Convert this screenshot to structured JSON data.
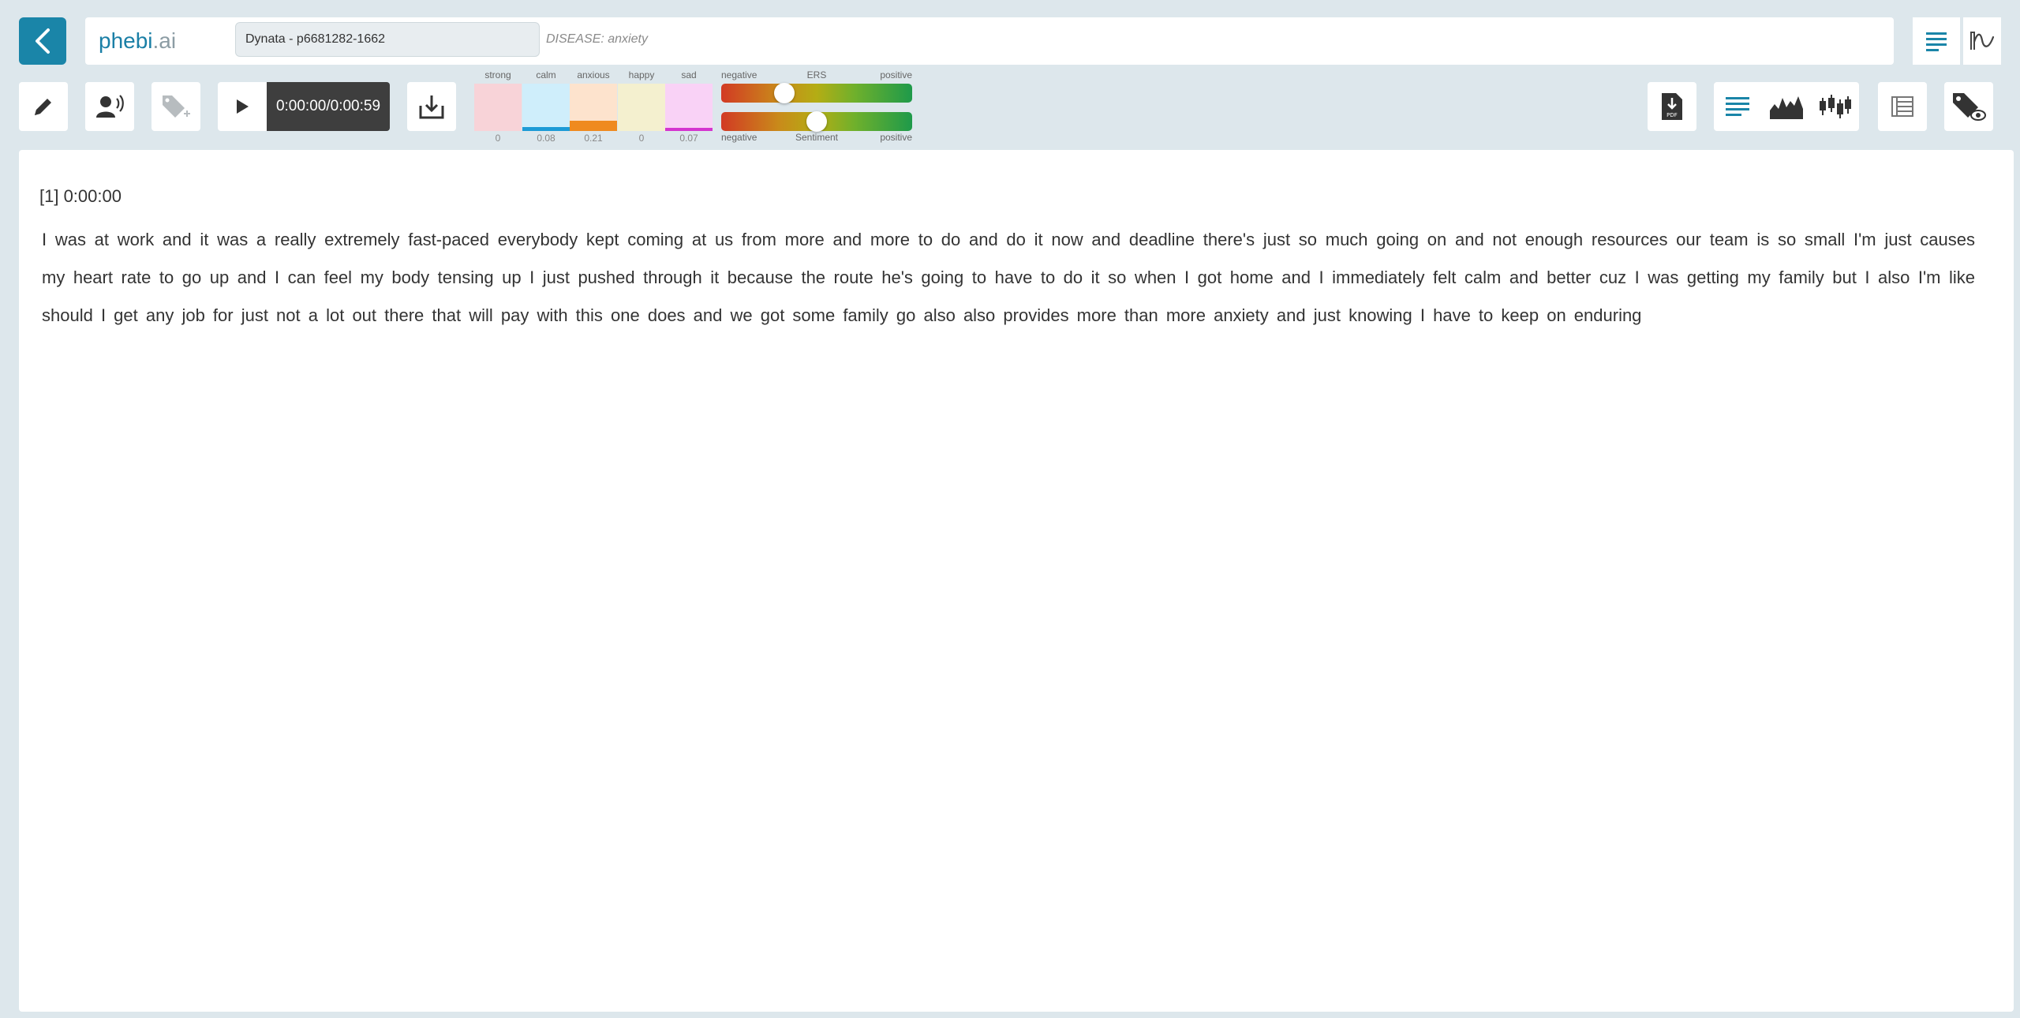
{
  "app": {
    "logo_part1": "phebi",
    "logo_part2": ".ai"
  },
  "header": {
    "project_value": "Dynata - p6681282-1662",
    "disease_label": "DISEASE: anxiety"
  },
  "player": {
    "time": "0:00:00/0:00:59"
  },
  "emotions": [
    {
      "label": "strong",
      "value": "0",
      "level": 0,
      "bg": "#f8d3d8",
      "fill": "#e45f74"
    },
    {
      "label": "calm",
      "value": "0.08",
      "level": 0.08,
      "bg": "#cfeefb",
      "fill": "#1d9bd6"
    },
    {
      "label": "anxious",
      "value": "0.21",
      "level": 0.21,
      "bg": "#fde3cd",
      "fill": "#ef8a1f"
    },
    {
      "label": "happy",
      "value": "0",
      "level": 0,
      "bg": "#f4f0cf",
      "fill": "#d8c43a"
    },
    {
      "label": "sad",
      "value": "0.07",
      "level": 0.07,
      "bg": "#f9d2f6",
      "fill": "#d435cf"
    }
  ],
  "ers": {
    "left": "negative",
    "title": "ERS",
    "right": "positive",
    "level": 0.33
  },
  "sentiment": {
    "left": "negative",
    "title": "Sentiment",
    "right": "positive",
    "level": 0.5
  },
  "transcript": {
    "segment_header": "[1] 0:00:00",
    "text": "I was at work and it was a really extremely fast-paced everybody kept coming at us from more and more to do and do it now and deadline there's just so much going on and not enough resources our team is so small I'm just causes my heart rate to go up and I can feel my body tensing up I just pushed through it because the route he's going to have to do it so when I got home and I immediately felt calm and better cuz I was getting my family but I also I'm like should I get any job for just not a lot out there that will pay with this one does and we got some family go also also provides more than more anxiety and just knowing I have to keep on enduring"
  },
  "icons": {
    "back": "chevron-left-icon",
    "edit": "pencil-icon",
    "speaker": "speaker-person-icon",
    "tag_add": "tag-add-icon",
    "play": "play-icon",
    "download": "download-icon",
    "pdf": "pdf-download-icon",
    "text_view": "lines-icon",
    "area_chart": "area-chart-icon",
    "candlestick": "candlestick-icon",
    "list": "list-icon",
    "tag_view": "tag-eye-icon",
    "wave": "wave-icon"
  },
  "colors": {
    "accent": "#1a85a8",
    "background": "#dde7ec",
    "player_dark": "#3e3e3e"
  }
}
